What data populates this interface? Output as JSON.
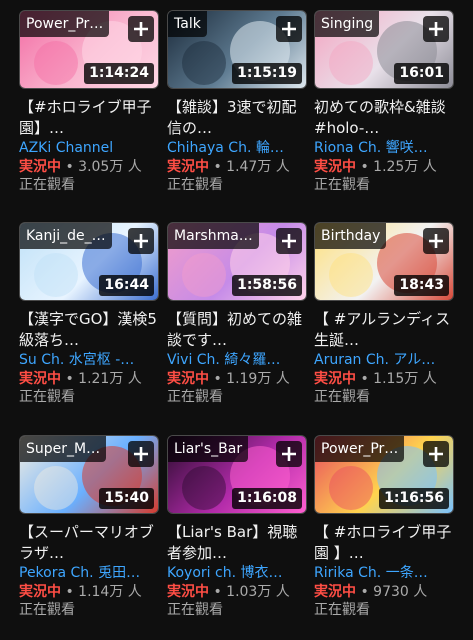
{
  "videos": [
    {
      "category": "Power_Pr…",
      "duration": "1:14:24",
      "title": "【#ホロライブ甲子園】…",
      "channel": "AZKi Channel",
      "live": "実況中",
      "views": "• 3.05万 人",
      "watching": "正在觀看",
      "colors": [
        "#f36ca4",
        "#f9b6cf",
        "#ffd7e6"
      ]
    },
    {
      "category": "Talk",
      "duration": "1:15:19",
      "title": "【雑談】3速で初配信の…",
      "channel": "Chihaya Ch. 輪…",
      "live": "実況中",
      "views": "• 1.47万 人",
      "watching": "正在觀看",
      "colors": [
        "#1b2a3a",
        "#5f7c92",
        "#dfe9f0"
      ]
    },
    {
      "category": "Singing",
      "duration": "16:01",
      "title": "初めての歌枠&雑談 #holo-…",
      "channel": "Riona Ch. 響咲…",
      "live": "実況中",
      "views": "• 1.25万 人",
      "watching": "正在觀看",
      "colors": [
        "#f4a3c0",
        "#e9e1ea",
        "#8c8c96"
      ]
    },
    {
      "category": "Kanji_de_…",
      "duration": "16:44",
      "title": "【漢字でGO】漢検5級落ち…",
      "channel": "Su Ch. 水宮枢 -…",
      "live": "実況中",
      "views": "• 1.21万 人",
      "watching": "正在觀看",
      "colors": [
        "#bfe1f7",
        "#e8f4ff",
        "#3d6fd1"
      ]
    },
    {
      "category": "Marshma…",
      "duration": "1:58:56",
      "title": "【質問】初めての雑談です…",
      "channel": "Vivi Ch. 綺々羅…",
      "live": "実況中",
      "views": "• 1.19万 人",
      "watching": "正在觀看",
      "colors": [
        "#f39dc9",
        "#c58be8",
        "#ffd2ea"
      ]
    },
    {
      "category": "Birthday",
      "duration": "18:43",
      "title": "【 #アルランディス生誕…",
      "channel": "Aruran Ch. アル…",
      "live": "実況中",
      "views": "• 1.15万 人",
      "watching": "正在觀看",
      "colors": [
        "#ffe07a",
        "#f2f2f2",
        "#d84a3a"
      ]
    },
    {
      "category": "Super_M…",
      "duration": "15:40",
      "title": "【スーパーマリオブラザ…",
      "channel": "Pekora Ch. 兎田…",
      "live": "実況中",
      "views": "• 1.14万 人",
      "watching": "正在觀看",
      "colors": [
        "#f4eee0",
        "#6ab0ff",
        "#d63c2f"
      ]
    },
    {
      "category": "Liar's_Bar",
      "duration": "1:16:08",
      "title": "【Liar's Bar】視聴者参加…",
      "channel": "Koyori ch. 博衣…",
      "live": "実況中",
      "views": "• 1.03万 人",
      "watching": "正在觀看",
      "colors": [
        "#2a0c2e",
        "#b02aa8",
        "#ff5fd0"
      ]
    },
    {
      "category": "Power_Pr…",
      "duration": "1:16:56",
      "title": "【 #ホロライブ甲子園 】…",
      "channel": "Ririka Ch. 一条…",
      "live": "実況中",
      "views": "• 9730 人",
      "watching": "正在觀看",
      "colors": [
        "#e84a5f",
        "#ffd34e",
        "#7ac3ff"
      ]
    }
  ]
}
